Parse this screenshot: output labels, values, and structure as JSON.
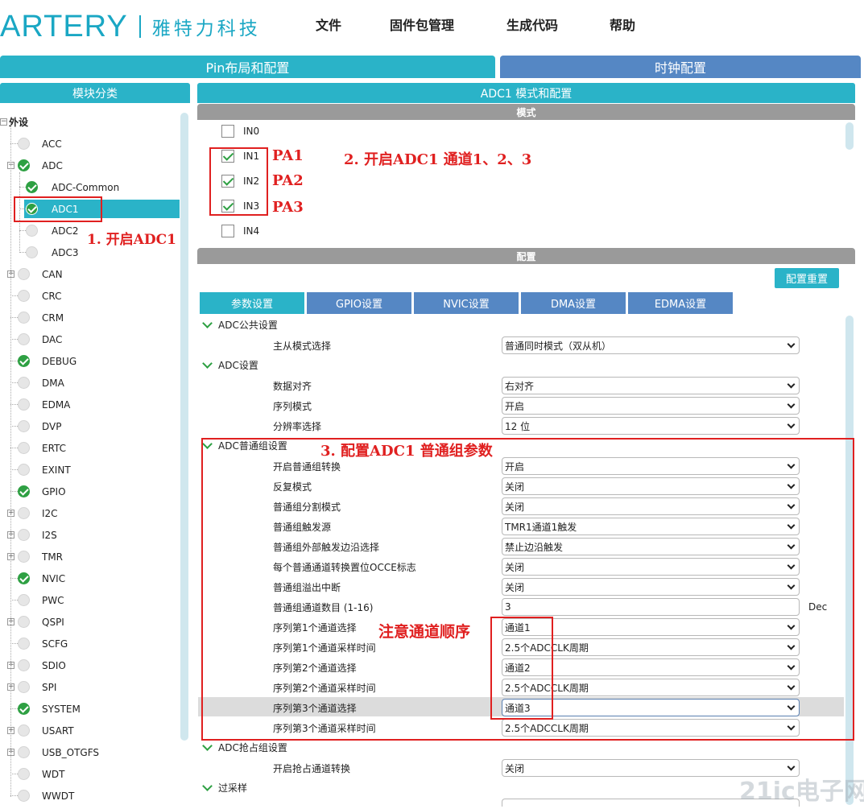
{
  "header": {
    "brand": "ARTERY",
    "brand_cn": "雅特力科技",
    "menu": [
      "文件",
      "固件包管理",
      "生成代码",
      "帮助"
    ]
  },
  "tabs": {
    "pin": "Pin布局和配置",
    "clock": "时钟配置"
  },
  "left": {
    "title": "模块分类",
    "root": "外设",
    "items": [
      {
        "label": "ACC",
        "status": "none"
      },
      {
        "label": "ADC",
        "status": "ok"
      },
      {
        "label": "ADC-Common",
        "status": "ok"
      },
      {
        "label": "ADC1",
        "status": "ok"
      },
      {
        "label": "ADC2",
        "status": "none"
      },
      {
        "label": "ADC3",
        "status": "none"
      },
      {
        "label": "CAN",
        "status": "none"
      },
      {
        "label": "CRC",
        "status": "none"
      },
      {
        "label": "CRM",
        "status": "none"
      },
      {
        "label": "DAC",
        "status": "none"
      },
      {
        "label": "DEBUG",
        "status": "ok"
      },
      {
        "label": "DMA",
        "status": "none"
      },
      {
        "label": "EDMA",
        "status": "none"
      },
      {
        "label": "DVP",
        "status": "none"
      },
      {
        "label": "ERTC",
        "status": "none"
      },
      {
        "label": "EXINT",
        "status": "none"
      },
      {
        "label": "GPIO",
        "status": "ok"
      },
      {
        "label": "I2C",
        "status": "none"
      },
      {
        "label": "I2S",
        "status": "none"
      },
      {
        "label": "TMR",
        "status": "none"
      },
      {
        "label": "NVIC",
        "status": "ok"
      },
      {
        "label": "PWC",
        "status": "none"
      },
      {
        "label": "QSPI",
        "status": "none"
      },
      {
        "label": "SCFG",
        "status": "none"
      },
      {
        "label": "SDIO",
        "status": "none"
      },
      {
        "label": "SPI",
        "status": "none"
      },
      {
        "label": "SYSTEM",
        "status": "ok"
      },
      {
        "label": "USART",
        "status": "none"
      },
      {
        "label": "USB_OTGFS",
        "status": "none"
      },
      {
        "label": "WDT",
        "status": "none"
      },
      {
        "label": "WWDT",
        "status": "none"
      }
    ]
  },
  "right": {
    "title": "ADC1 模式和配置",
    "mode_title": "模式",
    "channels": [
      {
        "label": "IN0",
        "checked": false
      },
      {
        "label": "IN1",
        "checked": true
      },
      {
        "label": "IN2",
        "checked": true
      },
      {
        "label": "IN3",
        "checked": true
      },
      {
        "label": "IN4",
        "checked": false
      }
    ],
    "config_title": "配置",
    "reset_button": "配置重置",
    "subtabs": [
      "参数设置",
      "GPIO设置",
      "NVIC设置",
      "DMA设置",
      "EDMA设置"
    ],
    "groups": {
      "common": "ADC公共设置",
      "adc": "ADC设置",
      "ordinary": "ADC普通组设置",
      "preempt": "ADC抢占组设置",
      "oversample": "过采样"
    },
    "params": [
      {
        "label": "主从模式选择",
        "value": "普通同时模式（双从机）"
      },
      {
        "label": "数据对齐",
        "value": "右对齐"
      },
      {
        "label": "序列模式",
        "value": "开启"
      },
      {
        "label": "分辨率选择",
        "value": "12 位"
      },
      {
        "label": "开启普通组转换",
        "value": "开启"
      },
      {
        "label": "反复模式",
        "value": "关闭"
      },
      {
        "label": "普通组分割模式",
        "value": "关闭"
      },
      {
        "label": "普通组触发源",
        "value": "TMR1通道1触发"
      },
      {
        "label": "普通组外部触发边沿选择",
        "value": "禁止边沿触发"
      },
      {
        "label": "每个普通通道转换置位OCCE标志",
        "value": "关闭"
      },
      {
        "label": "普通组溢出中断",
        "value": "关闭"
      },
      {
        "label": "普通组通道数目 (1-16)",
        "value": "3",
        "unit": "Dec"
      },
      {
        "label": "序列第1个通道选择",
        "value": "通道1"
      },
      {
        "label": "序列第1个通道采样时间",
        "value": "2.5个ADCCLK周期"
      },
      {
        "label": "序列第2个通道选择",
        "value": "通道2"
      },
      {
        "label": "序列第2个通道采样时间",
        "value": "2.5个ADCCLK周期"
      },
      {
        "label": "序列第3个通道选择",
        "value": "通道3"
      },
      {
        "label": "序列第3个通道采样时间",
        "value": "2.5个ADCCLK周期"
      },
      {
        "label": "开启抢占通道转换",
        "value": "关闭"
      }
    ]
  },
  "annotations": {
    "step1": "1. 开启ADC1",
    "step2": "2. 开启ADC1  通道1、2、3",
    "pa1": "PA1",
    "pa2": "PA2",
    "pa3": "PA3",
    "step3": "3. 配置ADC1  普通组参数",
    "note": "注意通道顺序"
  },
  "watermark": "21ic电子网",
  "colors": {
    "accent": "#2ab3c8",
    "tab_inactive": "#5587c4",
    "ok": "#2ea043",
    "annotation": "#e02020"
  }
}
